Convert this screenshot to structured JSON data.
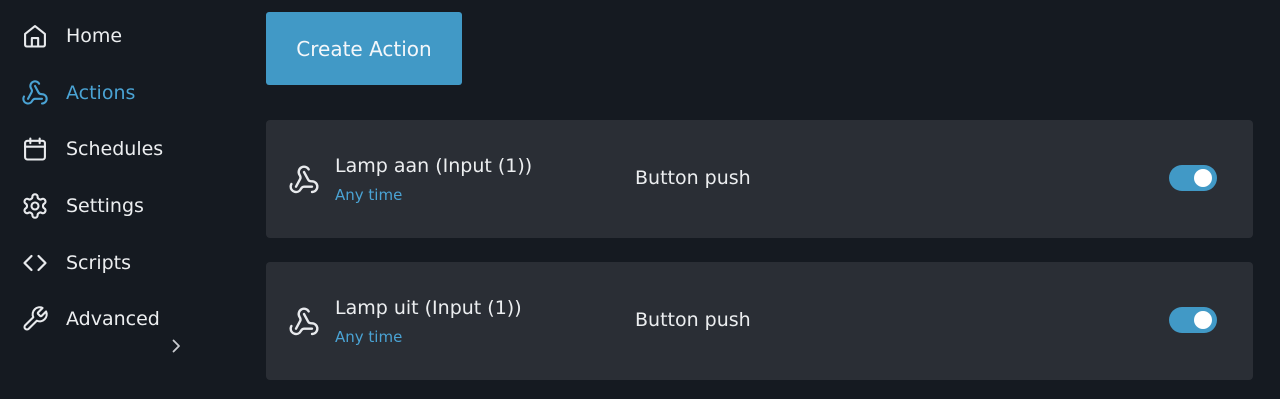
{
  "sidebar": {
    "items": [
      {
        "label": "Home",
        "icon": "home-icon",
        "active": false
      },
      {
        "label": "Actions",
        "icon": "webhook-icon",
        "active": true
      },
      {
        "label": "Schedules",
        "icon": "calendar-icon",
        "active": false
      },
      {
        "label": "Settings",
        "icon": "gear-icon",
        "active": false
      },
      {
        "label": "Scripts",
        "icon": "code-icon",
        "active": false
      },
      {
        "label": "Advanced",
        "icon": "wrench-icon",
        "active": false
      }
    ],
    "expand_icon": "chevron-right-icon"
  },
  "toolbar": {
    "create_label": "Create Action"
  },
  "actions": [
    {
      "title": "Lamp aan (Input (1))",
      "subtitle": "Any time",
      "trigger": "Button push",
      "enabled": true
    },
    {
      "title": "Lamp uit (Input (1))",
      "subtitle": "Any time",
      "trigger": "Button push",
      "enabled": true
    }
  ],
  "colors": {
    "background": "#151a21",
    "card": "#2a2e35",
    "accent": "#4199c6",
    "accent_text": "#4aa3d4",
    "text": "#eceef0"
  }
}
